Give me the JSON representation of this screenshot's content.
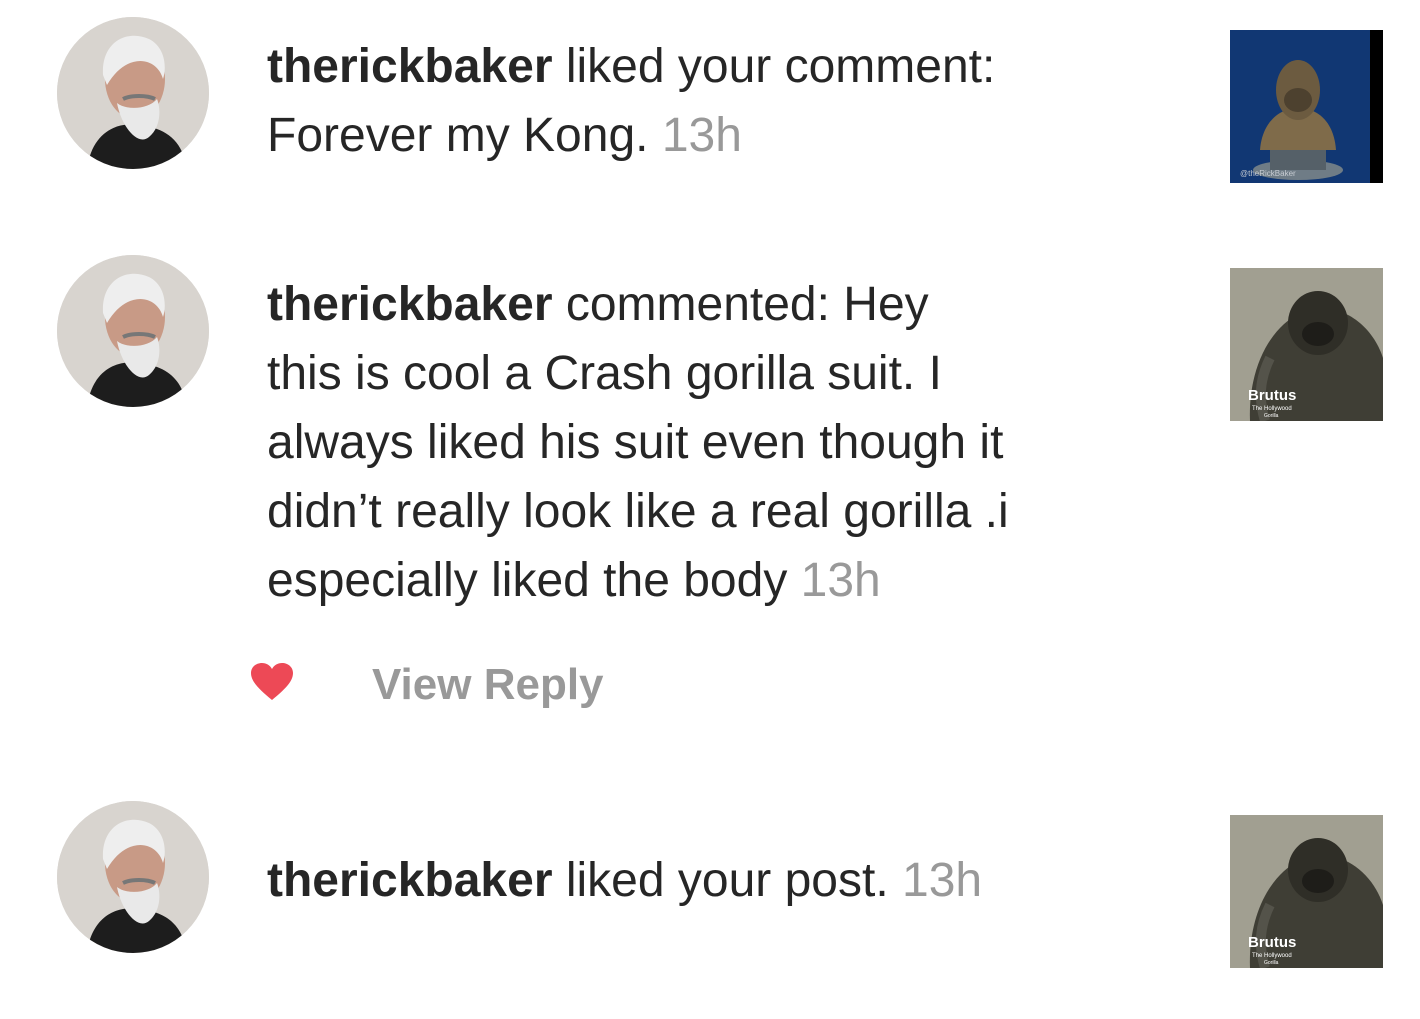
{
  "notifications": [
    {
      "username": "therickbaker",
      "action": " liked your comment:",
      "line2": "Forever my Kong.",
      "time": "13h"
    },
    {
      "username": "therickbaker",
      "action": " commented: Hey",
      "lines": [
        "this is cool a Crash  gorilla suit. I",
        "always liked his suit even though it",
        "didn’t really look like a real gorilla .i",
        "especially liked the body"
      ],
      "time": "13h",
      "thumb_title": "Brutus",
      "thumb_subtitle1": "The Hollywood",
      "thumb_subtitle2": "Gorilla",
      "view_reply": "View Reply"
    },
    {
      "username": "therickbaker",
      "action": " liked your post.",
      "time": "13h",
      "thumb_title": "Brutus",
      "thumb_subtitle1": "The Hollywood",
      "thumb_subtitle2": "Gorilla"
    }
  ],
  "thumb1_watermark": "@theRickBaker",
  "colors": {
    "heart": "#ed4956",
    "timestamp": "#999999",
    "text": "#262626"
  }
}
